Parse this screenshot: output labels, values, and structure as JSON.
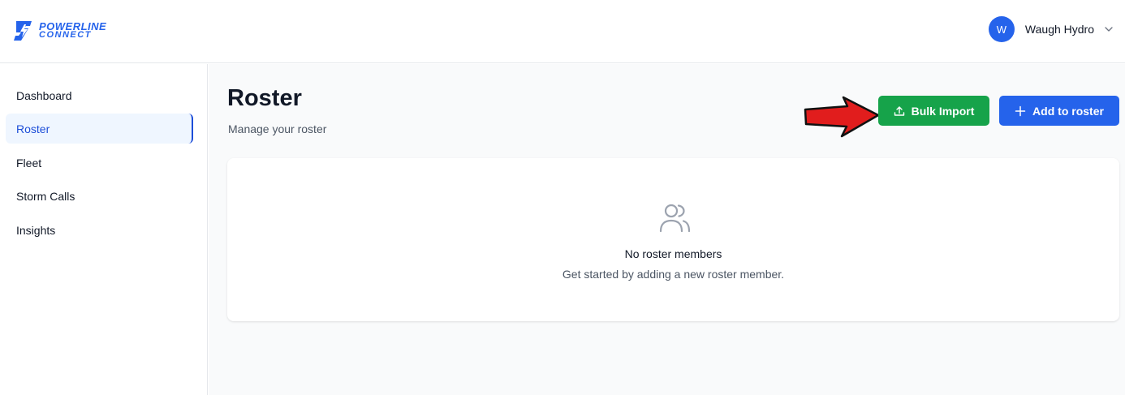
{
  "brand": {
    "line1": "POWERLINE",
    "line2": "CONNECT",
    "color": "#2563eb"
  },
  "user": {
    "initial": "W",
    "name": "Waugh Hydro"
  },
  "sidebar": {
    "items": [
      {
        "label": "Dashboard",
        "active": false
      },
      {
        "label": "Roster",
        "active": true
      },
      {
        "label": "Fleet",
        "active": false
      },
      {
        "label": "Storm Calls",
        "active": false
      },
      {
        "label": "Insights",
        "active": false
      }
    ]
  },
  "page": {
    "title": "Roster",
    "subtitle": "Manage your roster"
  },
  "actions": {
    "bulk_import": {
      "label": "Bulk Import",
      "icon": "upload-icon",
      "color": "#16a34a"
    },
    "add": {
      "label": "Add to roster",
      "icon": "plus-icon",
      "color": "#2563eb"
    }
  },
  "empty_state": {
    "icon": "users-icon",
    "title": "No roster members",
    "description": "Get started by adding a new roster member."
  },
  "annotation": {
    "icon": "red-arrow-icon",
    "color": "#e11d1d"
  }
}
